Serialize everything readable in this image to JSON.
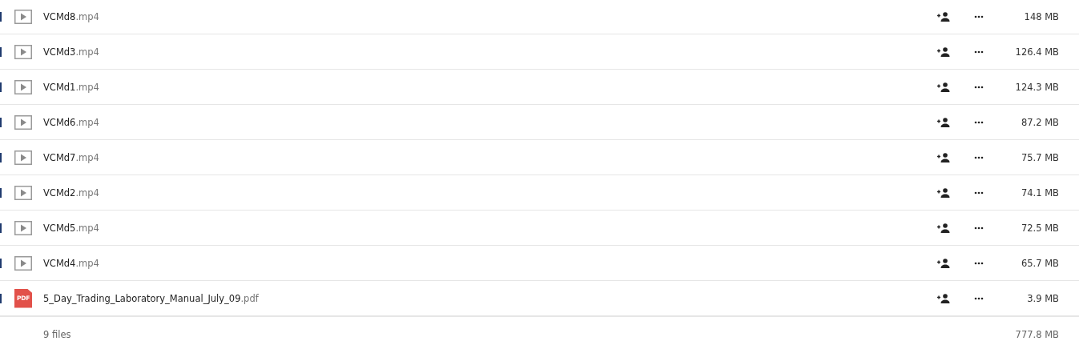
{
  "files": [
    {
      "kind": "video",
      "name": "VCMd8",
      "extension": ".mp4",
      "size": "148 MB"
    },
    {
      "kind": "video",
      "name": "VCMd3",
      "extension": ".mp4",
      "size": "126.4 MB"
    },
    {
      "kind": "video",
      "name": "VCMd1",
      "extension": ".mp4",
      "size": "124.3 MB"
    },
    {
      "kind": "video",
      "name": "VCMd6",
      "extension": ".mp4",
      "size": "87.2 MB"
    },
    {
      "kind": "video",
      "name": "VCMd7",
      "extension": ".mp4",
      "size": "75.7 MB"
    },
    {
      "kind": "video",
      "name": "VCMd2",
      "extension": ".mp4",
      "size": "74.1 MB"
    },
    {
      "kind": "video",
      "name": "VCMd5",
      "extension": ".mp4",
      "size": "72.5 MB"
    },
    {
      "kind": "video",
      "name": "VCMd4",
      "extension": ".mp4",
      "size": "65.7 MB"
    },
    {
      "kind": "pdf",
      "name": "5_Day_Trading_Laboratory_Manual_July_09",
      "extension": ".pdf",
      "size": "3.9 MB",
      "badge": "PDF"
    }
  ],
  "footer": {
    "count": "9 files",
    "total": "777.8 MB"
  }
}
